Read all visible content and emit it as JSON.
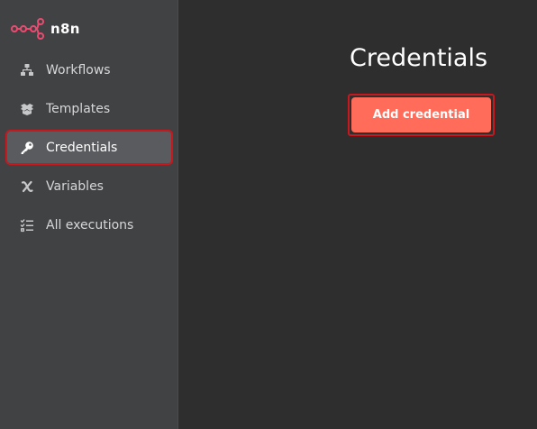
{
  "app": {
    "brand": "n8n",
    "accent_color": "#ea4b71",
    "button_color": "#ff6d5a",
    "highlight_color": "#c8181e"
  },
  "sidebar": {
    "items": [
      {
        "label": "Workflows",
        "icon": "workflows-icon",
        "active": false
      },
      {
        "label": "Templates",
        "icon": "templates-icon",
        "active": false
      },
      {
        "label": "Credentials",
        "icon": "key-icon",
        "active": true
      },
      {
        "label": "Variables",
        "icon": "variables-icon",
        "active": false
      },
      {
        "label": "All executions",
        "icon": "executions-list-icon",
        "active": false
      }
    ]
  },
  "main": {
    "title": "Credentials",
    "add_button_label": "Add credential"
  }
}
